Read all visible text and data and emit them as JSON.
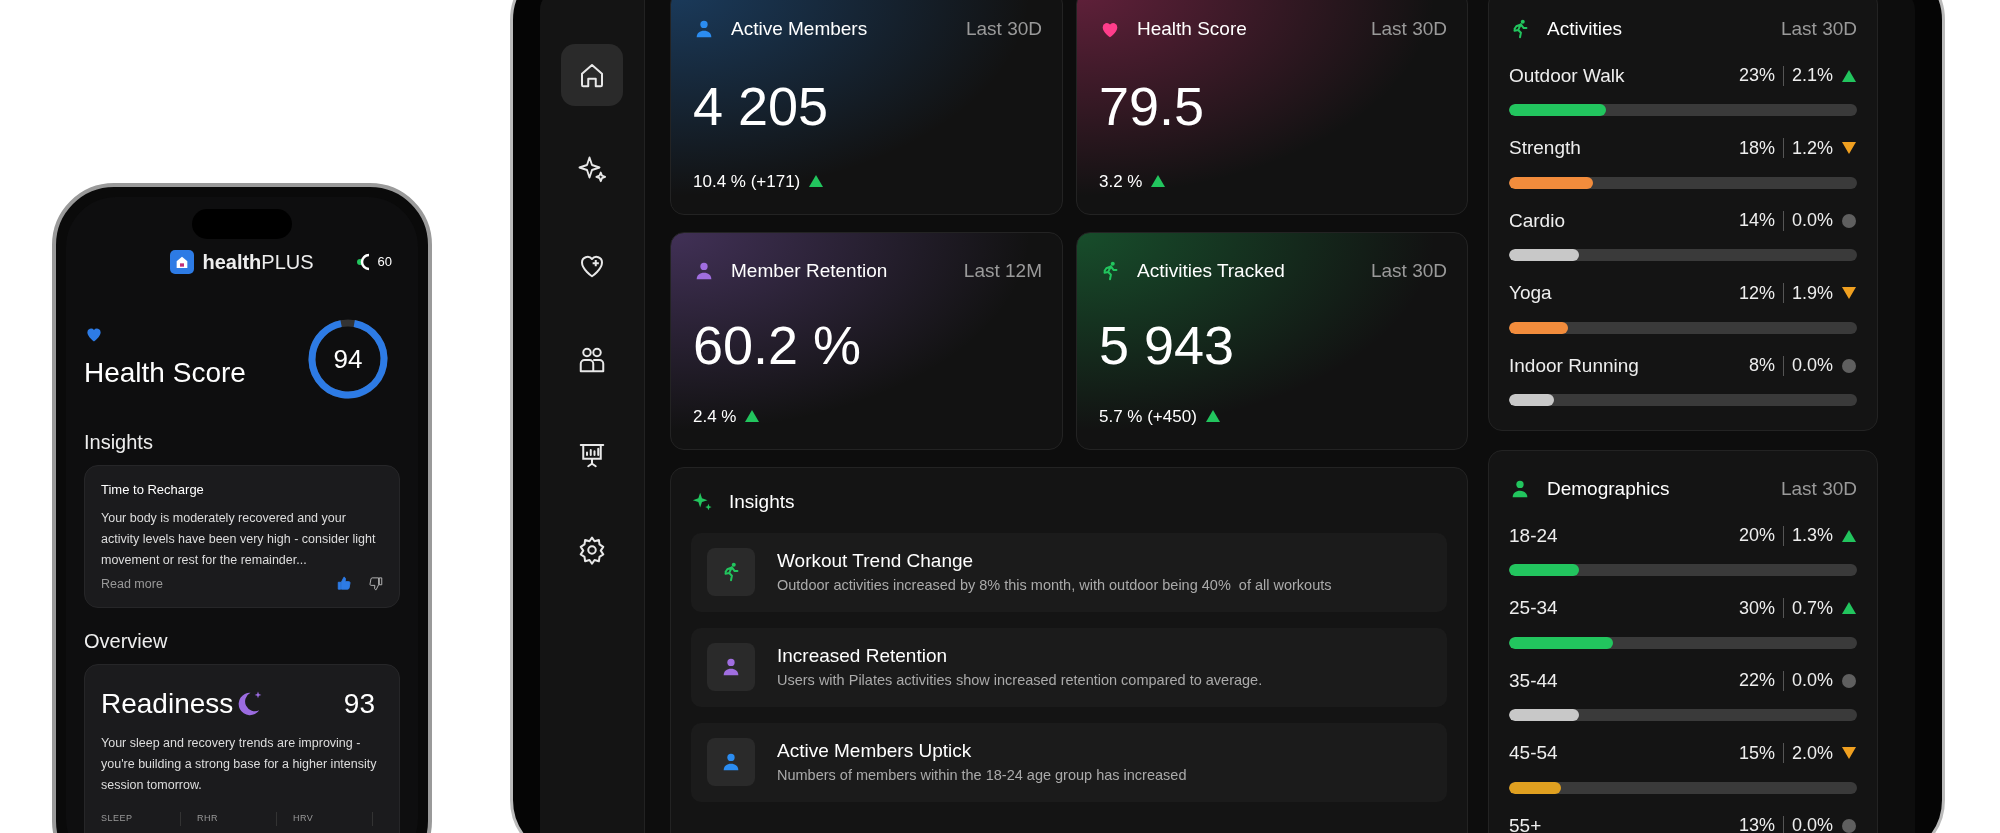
{
  "phone": {
    "app_title": "**health**PLUS",
    "battery": "60",
    "health_score": {
      "title": "Health Score",
      "value": "94",
      "level": 0.94
    },
    "insights_heading": "Insights",
    "insight": {
      "title": "Time to Recharge",
      "body": "Your body is moderately recovered and your activity levels have been very high - consider light movement or rest for the remainder...",
      "link": "Read more",
      "liked": true
    },
    "overview_heading": "Overview",
    "readiness": {
      "title": "Readiness",
      "value": "93",
      "body": "Your sleep and recovery trends are improving - you're building a strong base for a higher intensity session tomorrow.",
      "metrics": [
        "SLEEP",
        "RHR",
        "HRV"
      ]
    }
  },
  "dashboard": {
    "sidebar": {
      "items": [
        {
          "kind": "home",
          "selected": true
        },
        {
          "kind": "sparkle",
          "selected": false
        },
        {
          "kind": "heart-plus",
          "selected": false
        },
        {
          "kind": "people",
          "selected": false
        },
        {
          "kind": "chart",
          "selected": false
        },
        {
          "kind": "gear",
          "selected": false
        }
      ]
    },
    "stat_cards": [
      {
        "kind": "person",
        "title": "Active Members",
        "period": "Last 30D",
        "value": "4 205",
        "delta": "10.4 % (+171)",
        "trend": {
          "kind": "up"
        },
        "color": "#2b8cf0"
      },
      {
        "kind": "heart",
        "title": "Health Score",
        "period": "Last 30D",
        "value": "79.5",
        "delta": "3.2 %",
        "trend": {
          "kind": "up"
        },
        "color": "#ff3d8b"
      },
      {
        "kind": "person",
        "title": "Member Retention",
        "period": "Last 12M",
        "value": "60.2 %",
        "delta": "2.4 %",
        "trend": {
          "kind": "up"
        },
        "color": "#a06ee0"
      },
      {
        "kind": "runner",
        "title": "Activities Tracked",
        "period": "Last 30D",
        "value": "5 943",
        "delta": "5.7 % (+450)",
        "trend": {
          "kind": "up"
        },
        "color": "#22c55e"
      }
    ],
    "activities": {
      "title": "Activities",
      "period": "Last 30D",
      "items": [
        {
          "label": "Outdoor Walk",
          "share": "23%",
          "change": "2.1%",
          "trend": {
            "kind": "up"
          },
          "level": 0.28,
          "color": "#22c55e"
        },
        {
          "label": "Strength",
          "share": "18%",
          "change": "1.2%",
          "trend": {
            "kind": "down"
          },
          "level": 0.24,
          "color": "#f28c3c"
        },
        {
          "label": "Cardio",
          "share": "14%",
          "change": "0.0%",
          "trend": {
            "kind": "flat"
          },
          "level": 0.2,
          "color": "#c8c8c8"
        },
        {
          "label": "Yoga",
          "share": "12%",
          "change": "1.9%",
          "trend": {
            "kind": "down"
          },
          "level": 0.17,
          "color": "#f28c3c"
        },
        {
          "label": "Indoor Running",
          "share": "8%",
          "change": "0.0%",
          "trend": {
            "kind": "flat"
          },
          "level": 0.13,
          "color": "#c8c8c8"
        }
      ]
    },
    "insights": {
      "title": "Insights",
      "items": [
        {
          "kind": "runner",
          "color": "#22c55e",
          "title": "Workout Trend Change",
          "text": "Outdoor activities increased by 8% this month, with outdoor being 40%  of all workouts"
        },
        {
          "kind": "person",
          "color": "#a06ee0",
          "title": "Increased Retention",
          "text": "Users with Pilates activities show increased retention compared to average."
        },
        {
          "kind": "person",
          "color": "#2b8cf0",
          "title": "Active Members Uptick",
          "text": "Numbers of members within the 18-24 age group has increased"
        }
      ]
    },
    "demographics": {
      "title": "Demographics",
      "period": "Last 30D",
      "items": [
        {
          "label": "18-24",
          "share": "20%",
          "change": "1.3%",
          "trend": {
            "kind": "up"
          },
          "level": 0.2,
          "color": "#22c55e"
        },
        {
          "label": "25-34",
          "share": "30%",
          "change": "0.7%",
          "trend": {
            "kind": "up"
          },
          "level": 0.3,
          "color": "#22c55e"
        },
        {
          "label": "35-44",
          "share": "22%",
          "change": "0.0%",
          "trend": {
            "kind": "flat"
          },
          "level": 0.2,
          "color": "#c8c8c8"
        },
        {
          "label": "45-54",
          "share": "15%",
          "change": "2.0%",
          "trend": {
            "kind": "down"
          },
          "level": 0.15,
          "color": "#e0a020"
        },
        {
          "label": "55+",
          "share": "13%",
          "change": "0.0%",
          "trend": {
            "kind": "flat"
          }
        }
      ]
    }
  }
}
